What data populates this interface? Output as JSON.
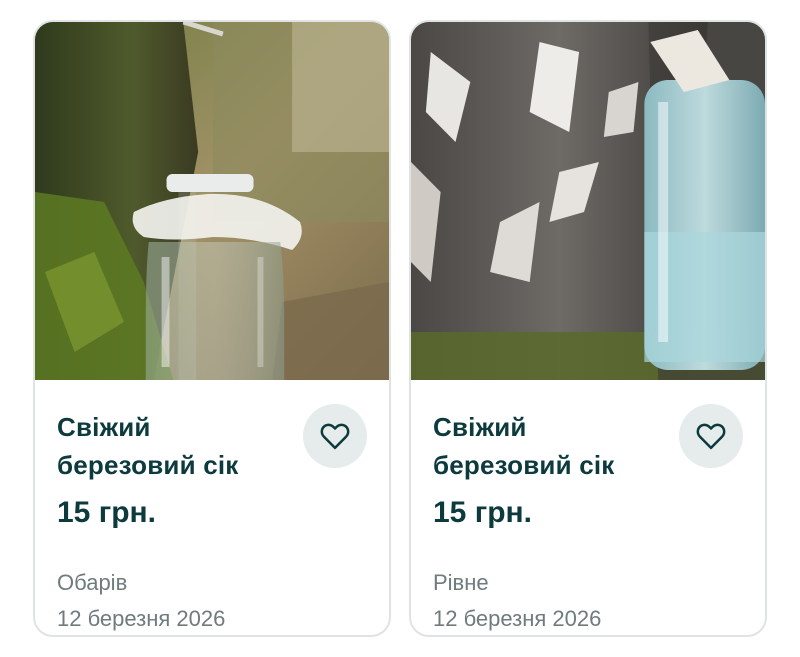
{
  "listings": [
    {
      "title": "Свіжий березовий сік",
      "price": "15 грн.",
      "city": "Обарів",
      "date": "12 березня 2026",
      "image_icon": "birch-sap-jar-photo"
    },
    {
      "title": "Свіжий березовий сік",
      "price": "15 грн.",
      "city": "Рівне",
      "date": "12 березня 2026",
      "image_icon": "birch-sap-jar-photo"
    }
  ],
  "colors": {
    "title": "#0c3a3d",
    "meta": "#6f7b7c",
    "fav_bg": "#e6ebec",
    "card_border": "#dfe3e4"
  },
  "icons": {
    "favorite": "heart-outline-icon"
  }
}
